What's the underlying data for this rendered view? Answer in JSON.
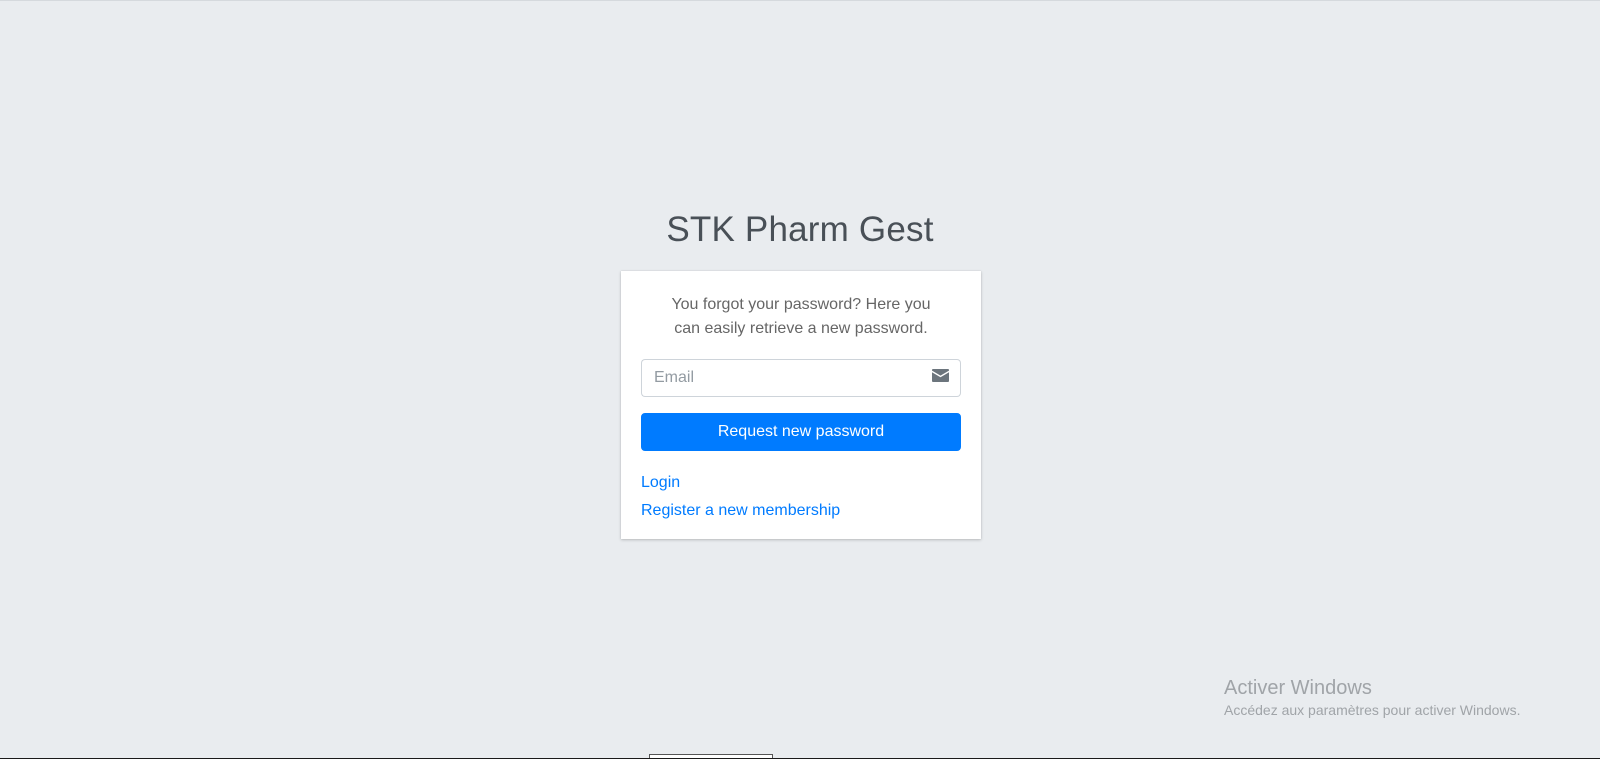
{
  "brand": {
    "strong": "STK",
    "light": " Pharm Gest"
  },
  "card": {
    "message": "You forgot your password? Here you can easily retrieve a new password.",
    "email_placeholder": "Email",
    "email_value": "",
    "email_icon": "envelope-icon",
    "submit_label": "Request new password",
    "login_link": "Login",
    "register_link": "Register a new membership"
  },
  "watermark": {
    "title": "Activer Windows",
    "subtitle": "Accédez aux paramètres pour activer Windows."
  },
  "colors": {
    "background": "#e9ecef",
    "primary": "#007bff",
    "text": "#495057"
  }
}
